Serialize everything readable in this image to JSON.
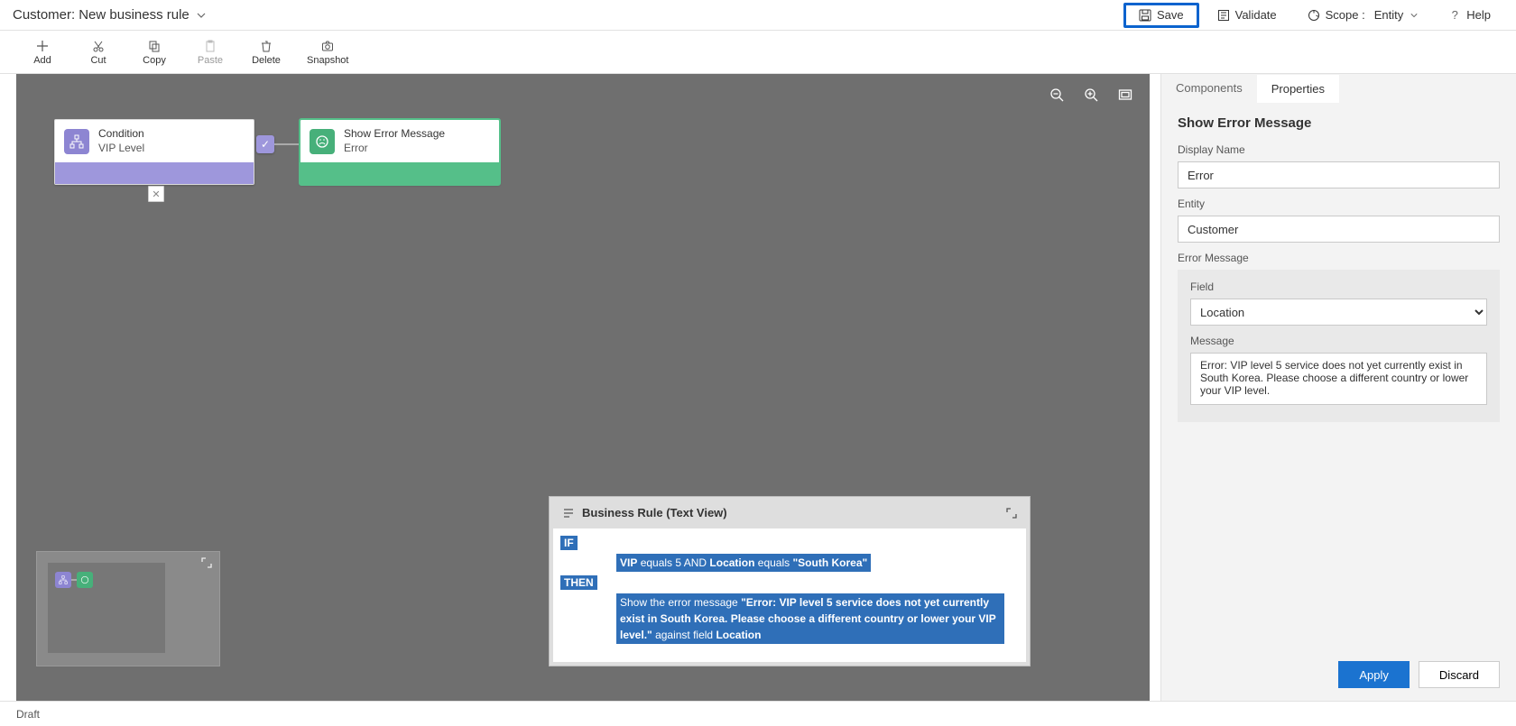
{
  "header": {
    "title_entity": "Customer",
    "title_name": "New business rule",
    "save": "Save",
    "validate": "Validate",
    "scope_label": "Scope :",
    "scope_value": "Entity",
    "help": "Help"
  },
  "ribbon": {
    "add": "Add",
    "cut": "Cut",
    "copy": "Copy",
    "paste": "Paste",
    "delete": "Delete",
    "snapshot": "Snapshot"
  },
  "nodes": {
    "condition": {
      "title": "Condition",
      "subtitle": "VIP Level"
    },
    "action": {
      "title": "Show Error Message",
      "subtitle": "Error"
    }
  },
  "textview": {
    "title": "Business Rule (Text View)",
    "if": "IF",
    "then": "THEN",
    "cond_field1": "VIP",
    "cond_op1": "equals 5 AND",
    "cond_field2": "Location",
    "cond_op2": "equals",
    "cond_val": "\"South Korea\"",
    "then_prefix": "Show the error message",
    "then_msg": "\"Error: VIP level 5 service does not yet currently exist in South Korea. Please choose a different country or lower your VIP level.\"",
    "then_suffix": "against field",
    "then_field": "Location"
  },
  "sidebar": {
    "tab_components": "Components",
    "tab_properties": "Properties",
    "section_title": "Show Error Message",
    "display_name_label": "Display Name",
    "display_name_value": "Error",
    "entity_label": "Entity",
    "entity_value": "Customer",
    "error_message_label": "Error Message",
    "field_label": "Field",
    "field_value": "Location",
    "message_label": "Message",
    "message_value": "Error: VIP level 5 service does not yet currently exist in South Korea. Please choose a different country or lower your VIP level.",
    "apply": "Apply",
    "discard": "Discard"
  },
  "status": {
    "draft": "Draft"
  }
}
